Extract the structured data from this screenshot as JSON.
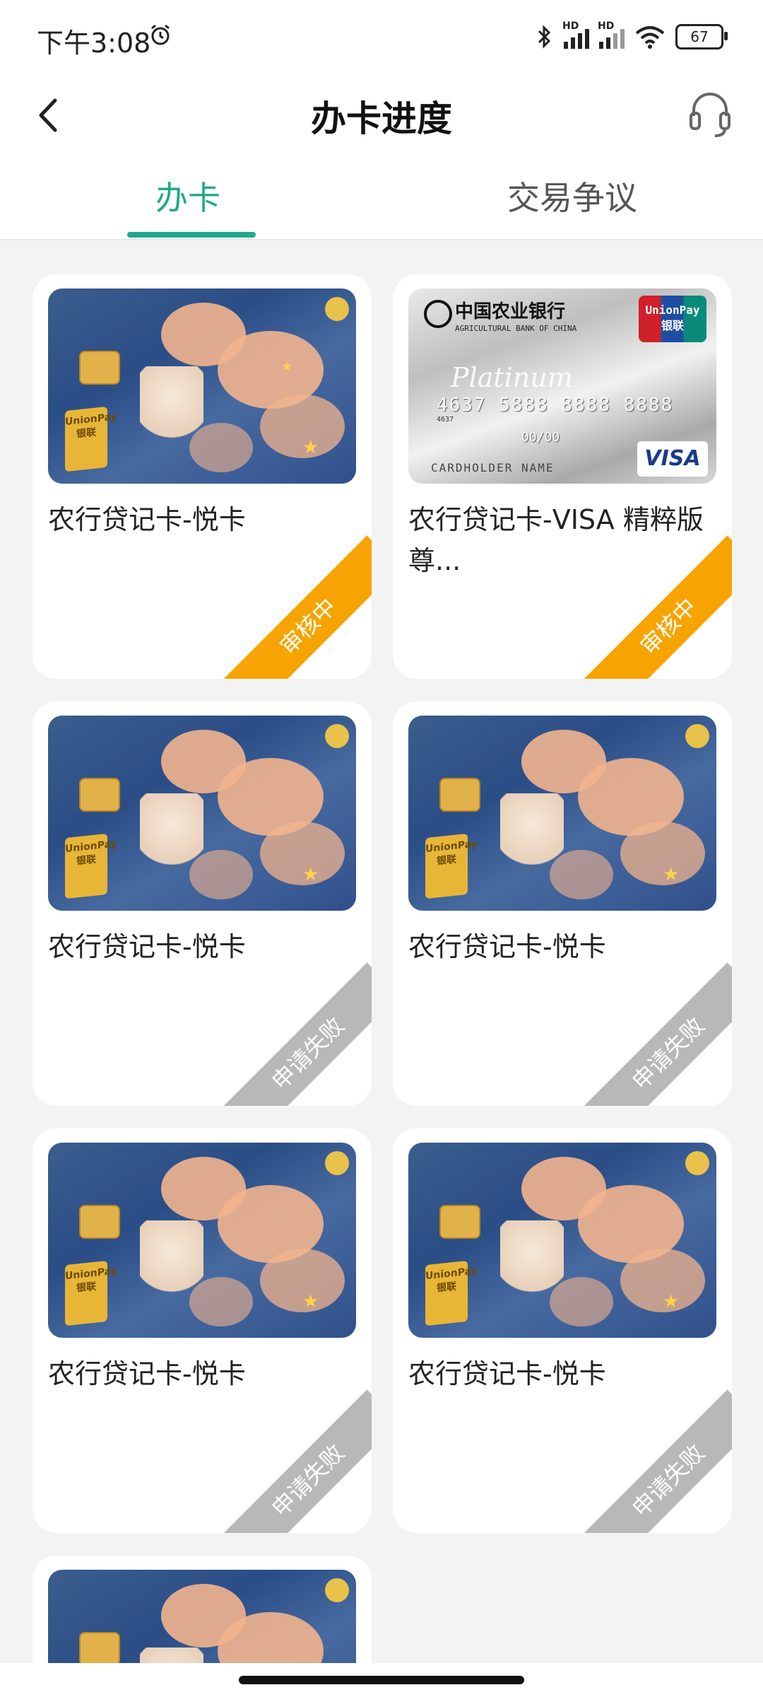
{
  "status_bar": {
    "time": "下午3:08",
    "battery": "67",
    "network_1": "HD",
    "network_2": "HD"
  },
  "header": {
    "title": "办卡进度"
  },
  "tabs": [
    {
      "label": "办卡",
      "active": true
    },
    {
      "label": "交易争议",
      "active": false
    }
  ],
  "colors": {
    "accent": "#21a88a",
    "pending": "#f7a400",
    "failed": "#b8b8b8"
  },
  "cards": [
    {
      "name": "农行贷记卡-悦卡",
      "status": "审核中",
      "art": "yue"
    },
    {
      "name": "农行贷记卡-VISA 精粹版尊...",
      "status": "审核中",
      "art": "platinum"
    },
    {
      "name": "农行贷记卡-悦卡",
      "status": "申请失败",
      "art": "yue"
    },
    {
      "name": "农行贷记卡-悦卡",
      "status": "申请失败",
      "art": "yue"
    },
    {
      "name": "农行贷记卡-悦卡",
      "status": "申请失败",
      "art": "yue"
    },
    {
      "name": "农行贷记卡-悦卡",
      "status": "申请失败",
      "art": "yue"
    },
    {
      "name": "",
      "status": "",
      "art": "yue"
    }
  ],
  "platinum_card": {
    "bank_name": "中国农业银行",
    "bank_en": "AGRICULTURAL BANK OF CHINA",
    "unionpay": "UnionPay 银联",
    "word": "Platinum",
    "number": "4637 5888 8888 8888",
    "small": "4637",
    "valid": "00/00",
    "holder": "CARDHOLDER NAME",
    "visa": "VISA"
  },
  "yue_card": {
    "unionpay": "UnionPay 银联"
  }
}
